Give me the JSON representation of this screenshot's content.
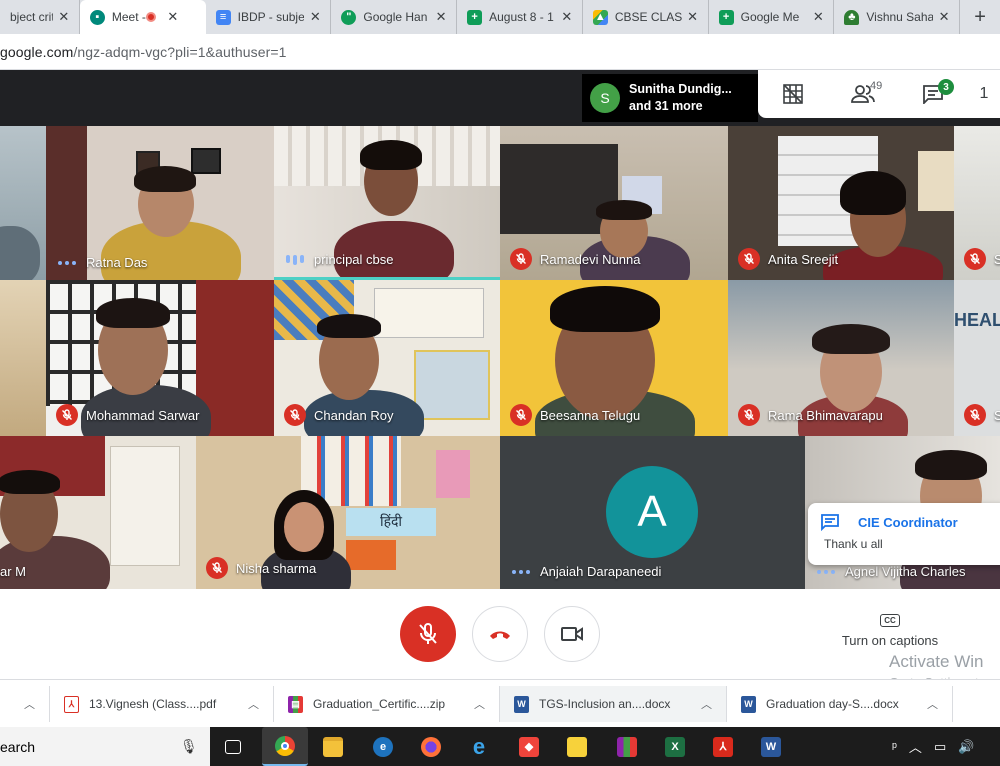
{
  "browser": {
    "tabs": [
      {
        "title": "bject crite",
        "color": "#fff",
        "icon": "document-icon"
      },
      {
        "title": "Meet - ",
        "color": "#00897b",
        "icon": "meet-icon",
        "active": true
      },
      {
        "title": "IBDP - subje",
        "color": "#4285f4",
        "icon": "docs-icon"
      },
      {
        "title": "Google Han",
        "color": "#0f9d58",
        "icon": "hangouts-icon"
      },
      {
        "title": "August 8 - 1",
        "color": "#0f9d58",
        "icon": "sheets-icon"
      },
      {
        "title": "CBSE CLASS",
        "color": "#fbbc04",
        "icon": "drive-icon"
      },
      {
        "title": "Google Me",
        "color": "#0f9d58",
        "icon": "sheets-icon"
      },
      {
        "title": "Vishnu Saha",
        "color": "#2e7d32",
        "icon": "tree-icon"
      }
    ],
    "url_main": "google.com",
    "url_rest": "/ngz-adqm-vgc?pli=1&authuser=1"
  },
  "meet": {
    "presenter_initial": "S",
    "presenter_line1": "Sunitha Dundig...",
    "presenter_line2": "and 31 more",
    "people_count": "49",
    "chat_badge": "3",
    "extra_count": "1",
    "participants": [
      "Ratna Das",
      "principal cbse",
      "Ramadevi Nunna",
      "Anita Sreejit",
      "Mohammad Sarwar",
      "Chandan Roy",
      "Beesanna Telugu",
      "Rama Bhimavarapu",
      "ar M",
      "Nisha sharma",
      "Anjaiah Darapaneedi",
      "Agnel Vijitha Charles",
      "S",
      "S"
    ],
    "avatar_letter": "A",
    "wall_sign": "HEALT",
    "hindi_sign": "हिंदी",
    "toast_title": "CIE Coordinator",
    "toast_message": "Thank u all",
    "captions_label": "Turn on captions",
    "cc_text": "CC",
    "watermark1": "Activate Win",
    "watermark2": "Go to Settings to"
  },
  "downloads": [
    {
      "name": "13.Vignesh (Class....pdf",
      "color": "#d93025",
      "icon": "pdf-icon"
    },
    {
      "name": "Graduation_Certific....zip",
      "color": "#8e24aa",
      "icon": "winrar-icon"
    },
    {
      "name": "TGS-Inclusion an....docx",
      "color": "#2b579a",
      "icon": "word-icon"
    },
    {
      "name": "Graduation day-S....docx",
      "color": "#2b579a",
      "icon": "word-icon"
    }
  ],
  "taskbar": {
    "search_text": "earch"
  }
}
